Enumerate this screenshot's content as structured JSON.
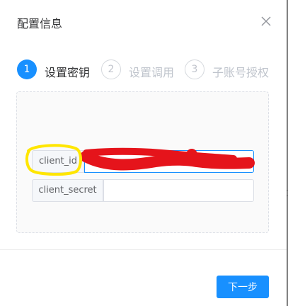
{
  "dialog": {
    "title": "配置信息",
    "close_icon": "close-icon"
  },
  "steps": [
    {
      "number": "1",
      "label": "设置密钥",
      "state": "active"
    },
    {
      "number": "2",
      "label": "设置调用",
      "state": "todo"
    },
    {
      "number": "3",
      "label": "子账号授权",
      "state": "todo"
    }
  ],
  "form": {
    "client_id": {
      "label": "client_id",
      "value": ""
    },
    "client_secret": {
      "label": "client_secret",
      "value": ""
    }
  },
  "footer": {
    "next_label": "下一步"
  },
  "annotations": {
    "highlight_color": "#ffe600",
    "redaction_color": "#e5141b"
  },
  "colors": {
    "primary": "#1890ff"
  }
}
